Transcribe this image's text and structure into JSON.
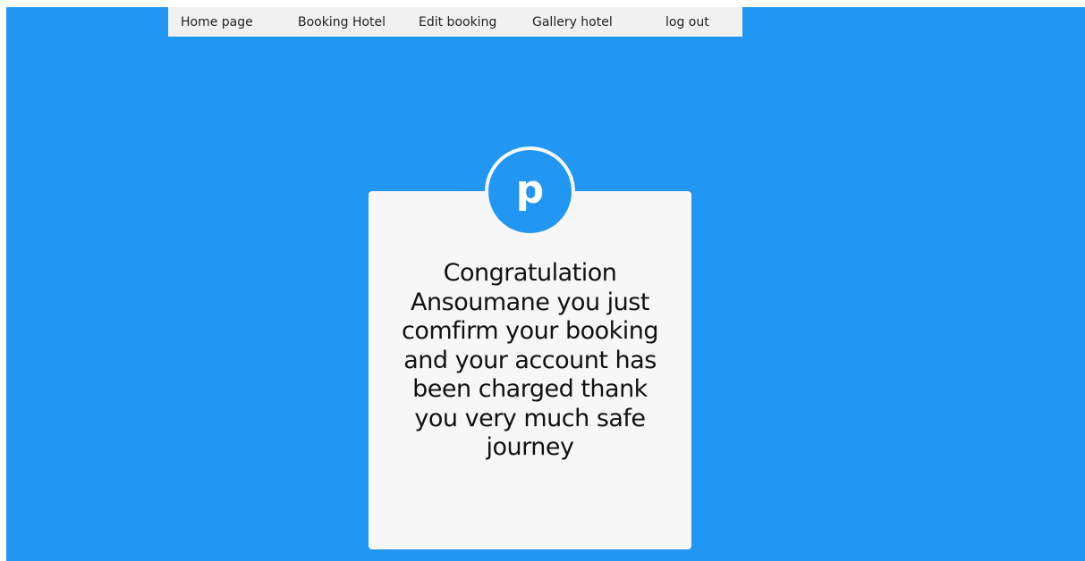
{
  "nav": {
    "items": [
      {
        "label": "Home page"
      },
      {
        "label": "Booking Hotel"
      },
      {
        "label": "Edit booking"
      },
      {
        "label": "Gallery hotel"
      },
      {
        "label": "log out"
      }
    ]
  },
  "logo": {
    "letter": "p"
  },
  "card": {
    "message": "Congratulation Ansoumane you just comfirm your booking and your account has been charged thank you very much safe journey"
  },
  "colors": {
    "background": "#2196f3",
    "nav_bg": "#f1f1f1",
    "card_bg": "#f7f7f7"
  }
}
